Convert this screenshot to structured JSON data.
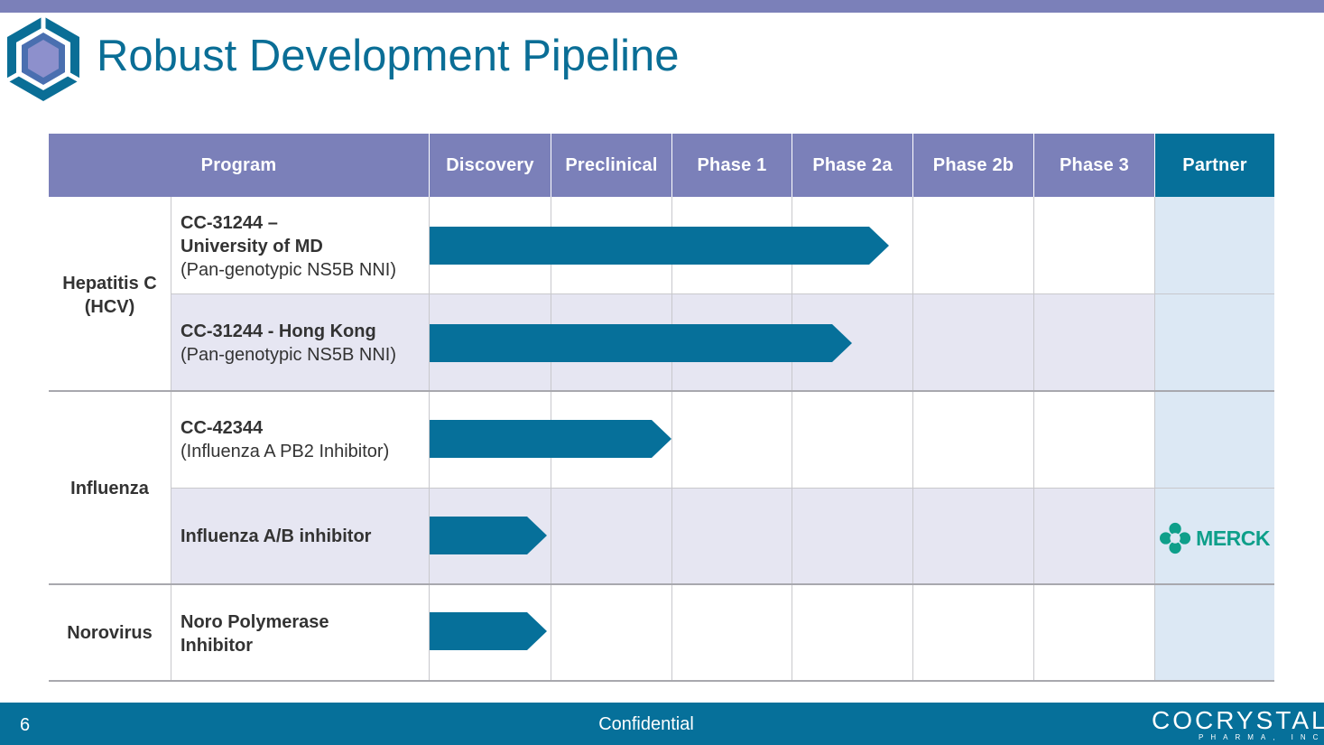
{
  "slide": {
    "title": "Robust Development Pipeline",
    "accent_color": "#0a6e96",
    "header_color": "#7b80b9",
    "partner_header_color": "#06709a",
    "logo_icon": "hexagon-logo-icon"
  },
  "table": {
    "headers": [
      "Program",
      "Discovery",
      "Preclinical",
      "Phase 1",
      "Phase 2a",
      "Phase 2b",
      "Phase 3",
      "Partner"
    ],
    "groups": [
      {
        "label": "Hepatitis C (HCV)"
      },
      {
        "label": "Influenza"
      },
      {
        "label": "Norovirus"
      }
    ],
    "rows": [
      {
        "name": "CC-31244 – University of MD",
        "detail": "(Pan-genotypic NS5B NNI)",
        "progress_label": "Phase 2a",
        "partner": ""
      },
      {
        "name": "CC-31244 - Hong Kong",
        "detail": "(Pan-genotypic NS5B NNI)",
        "progress_label": "Phase 2a",
        "partner": ""
      },
      {
        "name": "CC-42344",
        "detail": "(Influenza A PB2 Inhibitor)",
        "progress_label": "Preclinical",
        "partner": ""
      },
      {
        "name": "Influenza A/B inhibitor",
        "detail": "",
        "progress_label": "Discovery",
        "partner": "MERCK"
      },
      {
        "name": "Noro Polymerase Inhibitor",
        "detail": "",
        "progress_label": "Discovery",
        "partner": ""
      }
    ],
    "bar_color": "#06709a"
  },
  "footer": {
    "page_number": "6",
    "label": "Confidential",
    "brand": "COCRYSTAL",
    "brand_sub": "PHARMA, INC"
  }
}
